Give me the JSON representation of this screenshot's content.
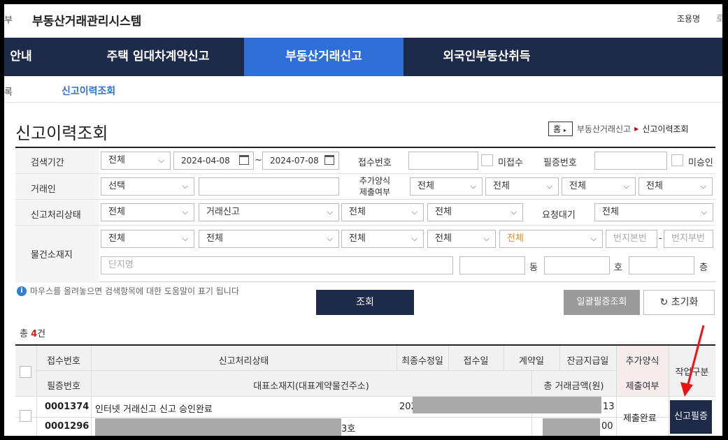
{
  "topbar": {
    "edge_left": "부",
    "title": "부동산거래관리시스템",
    "user": "조용명",
    "edge_right": "로"
  },
  "gnb": {
    "items": [
      "안내",
      "주택 임대차계약신고",
      "부동산거래신고",
      "외국인부동산취득"
    ],
    "active_index": 2
  },
  "lnb": {
    "edge": "록",
    "sub": "신고이력조회"
  },
  "page": {
    "title": "신고이력조회"
  },
  "breadcrumb": {
    "home": "홈",
    "parent": "부동산거래신고",
    "current": "신고이력조회"
  },
  "search": {
    "period_label": "검색기간",
    "period_value": "전체",
    "date_from": "2024-04-08",
    "tilde": "~",
    "date_to": "2024-07-08",
    "receipt_no_label": "접수번호",
    "unreceived_label": "미접수",
    "cert_no_label": "필증번호",
    "unapproved_label": "미승인",
    "trader_label": "거래인",
    "trader_value": "선택",
    "extra_form_label_1": "추가양식",
    "extra_form_label_2": "제출여부",
    "extra_values": [
      "전체",
      "전체",
      "전체",
      "전체"
    ],
    "status_label": "신고처리상태",
    "status_values": [
      "전체",
      "거래신고",
      "전체",
      "전체"
    ],
    "wait_label": "요청대기",
    "wait_value": "전체",
    "location_label": "물건소재지",
    "location_values": [
      "전체",
      "전체",
      "전체",
      "전체",
      "전체"
    ],
    "main_no_placeholder": "번지본번",
    "dash": "-",
    "sub_no_placeholder": "번지부번",
    "complex_placeholder": "단지명",
    "dong_label": "동",
    "ho_label": "호",
    "floor_label": "층"
  },
  "help_text": "마우스를 올려놓으면 검색항목에 대한 도움말이 표기 됩니다",
  "buttons": {
    "search": "조회",
    "bulk_cert": "일괄필증조회",
    "reset": "초기화"
  },
  "total": {
    "prefix": "총 ",
    "count": "4",
    "suffix": "건"
  },
  "grid": {
    "headers_top": [
      "접수번호",
      "신고처리상태",
      "최종수정일",
      "접수일",
      "계약일",
      "잔금지급일",
      "추가양식"
    ],
    "headers_bottom": [
      "필증번호",
      "대표소재지(대표계약물건주소)",
      "총 거래금액(원)",
      "제출여부"
    ],
    "work_type": "작업구분",
    "rows": [
      {
        "receipt_no": "0001374",
        "status": "인터넷 거래신고 신고 승인완료",
        "modified_partial": "202",
        "cell_tail": "13",
        "cert_no": "0001296",
        "addr_tail": "3호",
        "amount_tail": "00",
        "extra_submit": "제출완료",
        "action": "신고필증"
      }
    ]
  },
  "colors": {
    "navy": "#1d2a4a",
    "active_blue": "#2f6fd8",
    "highlight_red": "#d02020",
    "arrow_red": "#ee1111"
  }
}
